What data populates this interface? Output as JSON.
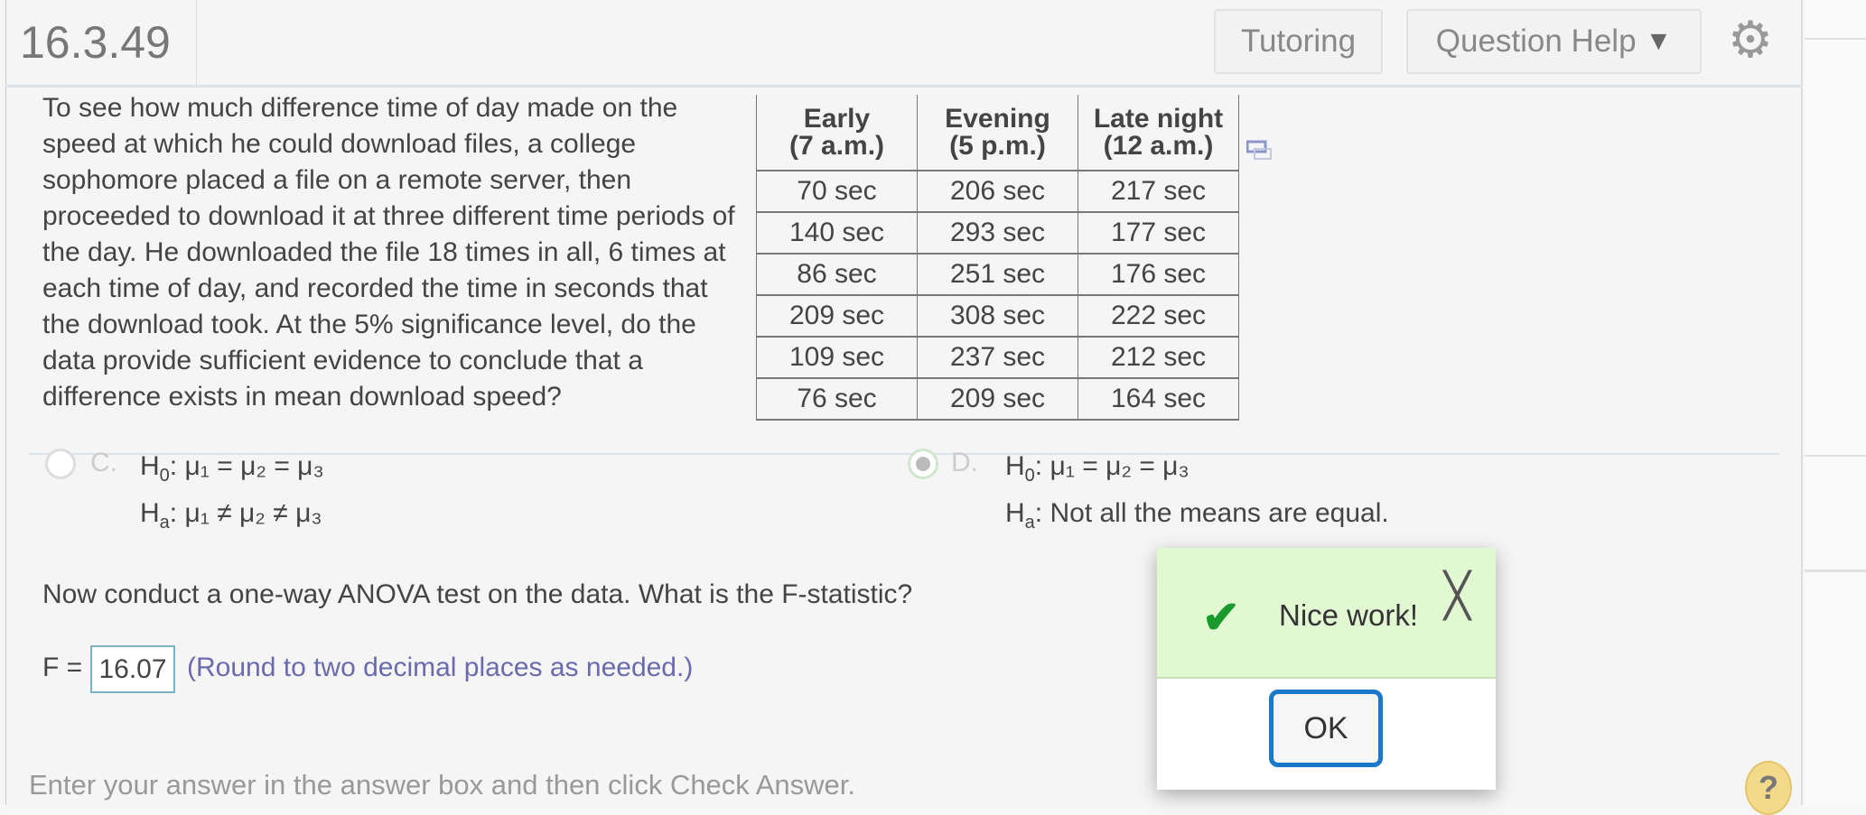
{
  "header": {
    "title": "16.3.49",
    "tutoring": "Tutoring",
    "question_help": "Question Help",
    "question_help_arrow": "▼",
    "gear": "⚙"
  },
  "problem": {
    "text": "To see how much difference time of day made on the speed at which he could download files, a college sophomore placed a file on a remote server, then proceeded to download it at three different time periods of the day. He downloaded the file 18 times in all, 6 times at each time of day, and recorded the time in seconds that the download took. At the 5% significance level, do the data provide sufficient evidence to conclude that a difference exists in mean download speed?"
  },
  "table": {
    "headers": [
      [
        "Early",
        "(7 a.m.)"
      ],
      [
        "Evening",
        "(5 p.m.)"
      ],
      [
        "Late night",
        "(12 a.m.)"
      ]
    ],
    "rows": [
      [
        "70 sec",
        "206 sec",
        "217 sec"
      ],
      [
        "140 sec",
        "293 sec",
        "177 sec"
      ],
      [
        "86 sec",
        "251 sec",
        "176 sec"
      ],
      [
        "209 sec",
        "308 sec",
        "222 sec"
      ],
      [
        "109 sec",
        "237 sec",
        "212 sec"
      ],
      [
        "76 sec",
        "209 sec",
        "164 sec"
      ]
    ]
  },
  "options": {
    "c": {
      "letter": "C.",
      "h0": "μ₁ = μ₂ = μ₃",
      "ha": "μ₁ ≠ μ₂ ≠ μ₃"
    },
    "d": {
      "letter": "D.",
      "h0": "μ₁ = μ₂ = μ₃",
      "ha": "Not all the means are equal."
    },
    "h0_label": "H",
    "h0_sub": "0",
    "ha_label": "H",
    "ha_sub": "a"
  },
  "question2": "Now conduct a one-way ANOVA test on the data. What is the F-statistic?",
  "answer": {
    "label": "F =",
    "value": "16.07",
    "hint": "(Round to two decimal places as needed.)"
  },
  "footer": "Enter your answer in the answer box and then click Check Answer.",
  "popup": {
    "message": "Nice work!",
    "ok": "OK",
    "check": "✔",
    "close": "╳"
  },
  "help": "?"
}
